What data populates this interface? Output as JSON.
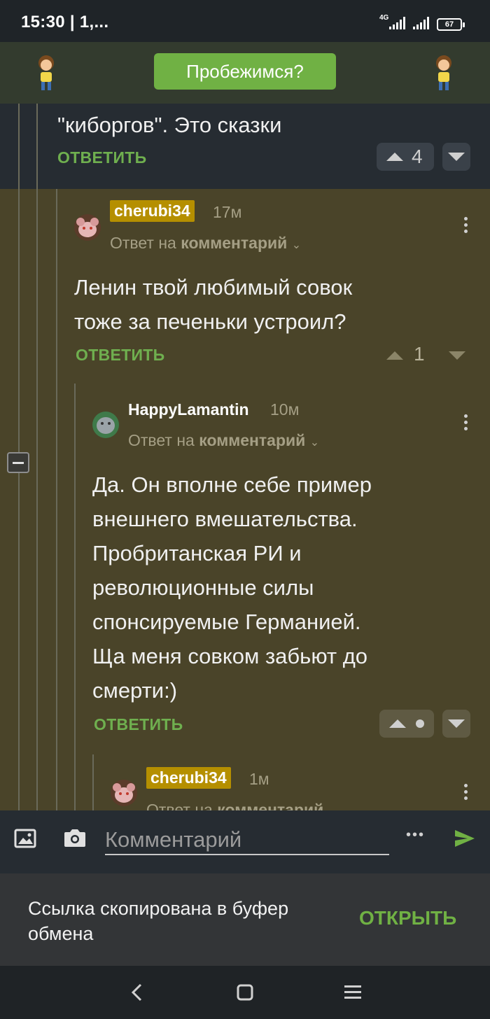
{
  "status_bar": {
    "time": "15:30 | 1,...",
    "network": "4G",
    "battery": "67"
  },
  "top_bar": {
    "run_button": "Пробежимся?"
  },
  "comments": {
    "c1": {
      "text": "\"киборгов\". Это сказки",
      "reply_label": "ОТВЕТИТЬ",
      "score": "4"
    },
    "c2": {
      "username": "cherubi34",
      "time": "17м",
      "reply_to_prefix": "Ответ на",
      "reply_to_link": "комментарий",
      "text_line1": "Ленин твой любимый совок",
      "text_line2": "тоже за печеньки устроил?",
      "reply_label": "ОТВЕТИТЬ",
      "score": "1"
    },
    "c3": {
      "username": "HappyLamantin",
      "time": "10м",
      "reply_to_prefix": "Ответ на",
      "reply_to_link": "комментарий",
      "lines": [
        "Да. Он вполне себе пример",
        "внешнего вмешательства.",
        "Пробританская РИ и",
        "революционные силы",
        "спонсируемые Германией.",
        "Ща меня совком забьют до",
        "смерти:)"
      ],
      "reply_label": "ОТВЕТИТЬ"
    },
    "c4": {
      "username": "cherubi34",
      "time": "1м",
      "reply_to_prefix": "Ответ на",
      "reply_to_link": "комментарий"
    }
  },
  "input_bar": {
    "placeholder": "Комментарий",
    "more": "•••"
  },
  "snackbar": {
    "message": "Ссылка скопирована в буфер обмена",
    "action": "ОТКРЫТЬ"
  },
  "colors": {
    "accent": "#70b144",
    "badge": "#b58f00",
    "olive_bg": "#4a4429",
    "dark_bg": "#262c32"
  }
}
